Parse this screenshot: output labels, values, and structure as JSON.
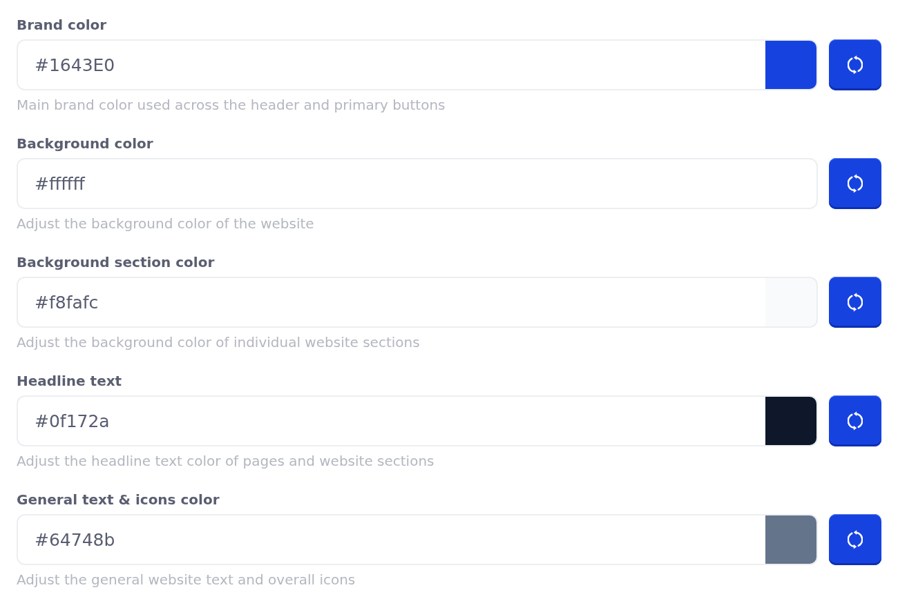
{
  "fields": [
    {
      "label": "Brand color",
      "value": "#1643E0",
      "color": "#1643e0",
      "help": "Main brand color used across the header and primary buttons"
    },
    {
      "label": "Background color",
      "value": "#ffffff",
      "help": "Adjust the background color of the website"
    },
    {
      "label": "Background section color",
      "value": "#f8fafc",
      "color": "#f8fafc",
      "help": "Adjust the background color of individual website sections"
    },
    {
      "label": "Headline text",
      "value": "#0f172a",
      "color": "#0f172a",
      "help": "Adjust the headline text color of pages and website sections"
    },
    {
      "label": "General text & icons color",
      "value": "#64748b",
      "color": "#64748b",
      "help": "Adjust the general website text and overall icons"
    }
  ]
}
